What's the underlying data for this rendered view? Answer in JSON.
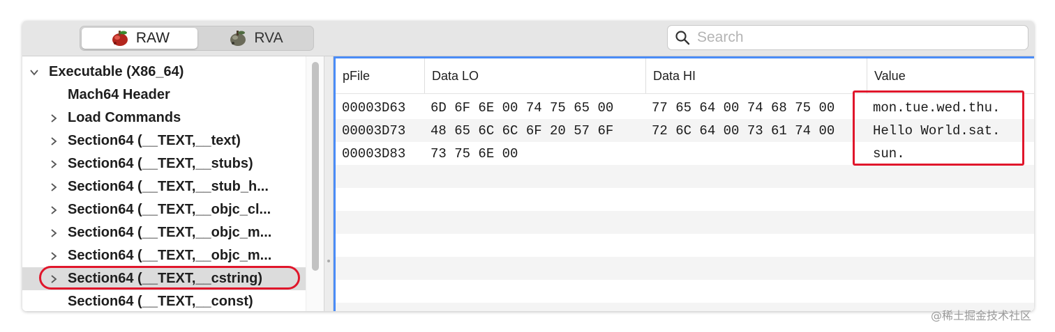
{
  "toolbar": {
    "segments": [
      {
        "label": "RAW",
        "icon": "raw-mode-icon",
        "selected": true
      },
      {
        "label": "RVA",
        "icon": "rva-mode-icon",
        "selected": false
      }
    ],
    "search": {
      "placeholder": "Search",
      "value": ""
    }
  },
  "sidebar": {
    "items": [
      {
        "label": "Executable  (X86_64)",
        "expanded": true,
        "has_children": true
      },
      {
        "label": "Mach64 Header",
        "has_children": false
      },
      {
        "label": "Load Commands",
        "has_children": true
      },
      {
        "label": "Section64 (__TEXT,__text)",
        "has_children": true
      },
      {
        "label": "Section64 (__TEXT,__stubs)",
        "has_children": true
      },
      {
        "label": "Section64 (__TEXT,__stub_h...",
        "has_children": true
      },
      {
        "label": "Section64 (__TEXT,__objc_cl...",
        "has_children": true
      },
      {
        "label": "Section64 (__TEXT,__objc_m...",
        "has_children": true
      },
      {
        "label": "Section64 (__TEXT,__objc_m...",
        "has_children": true
      },
      {
        "label": "Section64 (__TEXT,__cstring)",
        "has_children": true,
        "selected": true
      },
      {
        "label": "Section64 (__TEXT,__const)",
        "has_children": false
      }
    ]
  },
  "table": {
    "columns": [
      "pFile",
      "Data LO",
      "Data HI",
      "Value"
    ],
    "rows": [
      {
        "pfile": "00003D63",
        "data_lo": "6D 6F 6E 00 74 75 65 00",
        "data_hi": "77 65 64 00 74 68 75 00",
        "value": "mon.tue.wed.thu."
      },
      {
        "pfile": "00003D73",
        "data_lo": "48 65 6C 6C 6F 20 57 6F",
        "data_hi": "72 6C 64 00 73 61 74 00",
        "value": "Hello World.sat."
      },
      {
        "pfile": "00003D83",
        "data_lo": "73 75 6E 00",
        "data_hi": "",
        "value": "sun."
      }
    ]
  },
  "watermark": "@稀土掘金技术社区",
  "colors": {
    "accent": "#4a8cf7",
    "annotation": "#e0162b",
    "selection": "#dcdcdc"
  }
}
